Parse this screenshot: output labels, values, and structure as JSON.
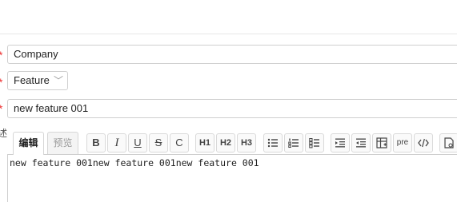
{
  "form": {
    "required_mark": "*",
    "company_value": "Company",
    "type_value": "Feature",
    "title_value": "new feature 001",
    "desc_label": "述"
  },
  "editor": {
    "tabs": [
      {
        "label": "编辑",
        "active": true
      },
      {
        "label": "预览",
        "active": false
      }
    ],
    "toolbar": {
      "bold": "B",
      "italic": "I",
      "underline": "U",
      "strike": "S",
      "clear": "C",
      "h1": "H1",
      "h2": "H2",
      "h3": "H3",
      "pre": "pre"
    },
    "content": "new feature 001new feature 001new feature 001"
  }
}
